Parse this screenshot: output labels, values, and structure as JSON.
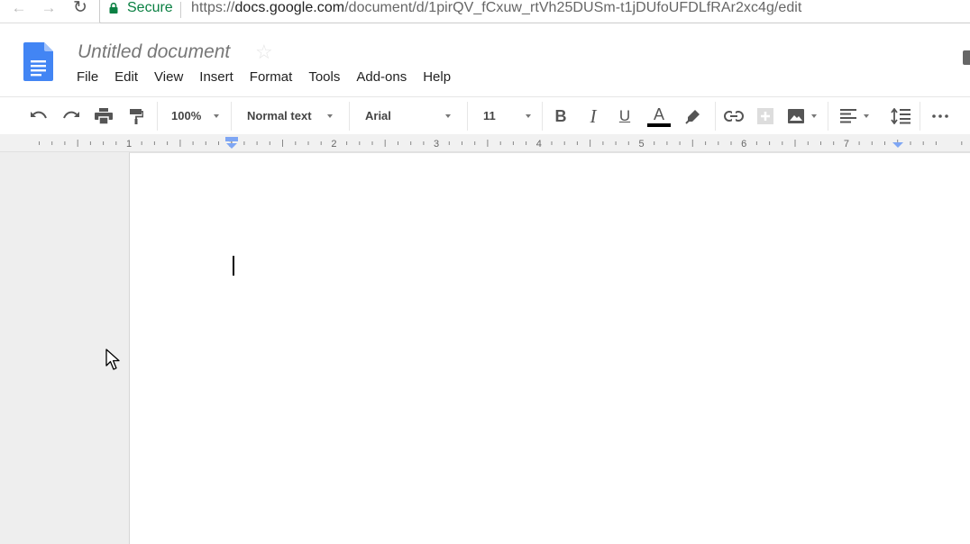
{
  "browser": {
    "secure_label": "Secure",
    "url_scheme": "https://",
    "url_host": "docs.google.com",
    "url_path": "/document/d/1pirQV_fCxuw_rtVh25DUSm-t1jDUfoUFDLfRAr2xc4g/edit"
  },
  "header": {
    "title": "Untitled document",
    "logo_icon": "google-docs-logo",
    "menu": [
      "File",
      "Edit",
      "View",
      "Insert",
      "Format",
      "Tools",
      "Add-ons",
      "Help"
    ]
  },
  "toolbar": {
    "zoom": "100%",
    "style": "Normal text",
    "font": "Arial",
    "size": "11",
    "bold_label": "B",
    "italic_label": "I",
    "underline_label": "U",
    "text_color_label": "A",
    "text_color": "#000000"
  },
  "ruler": {
    "labels": [
      "1",
      "1",
      "2",
      "3",
      "4",
      "5",
      "6",
      "7"
    ]
  },
  "colors": {
    "docs_blue": "#4285f4",
    "secure_green": "#0b8043",
    "ruler_marker": "#7ea6f4"
  }
}
